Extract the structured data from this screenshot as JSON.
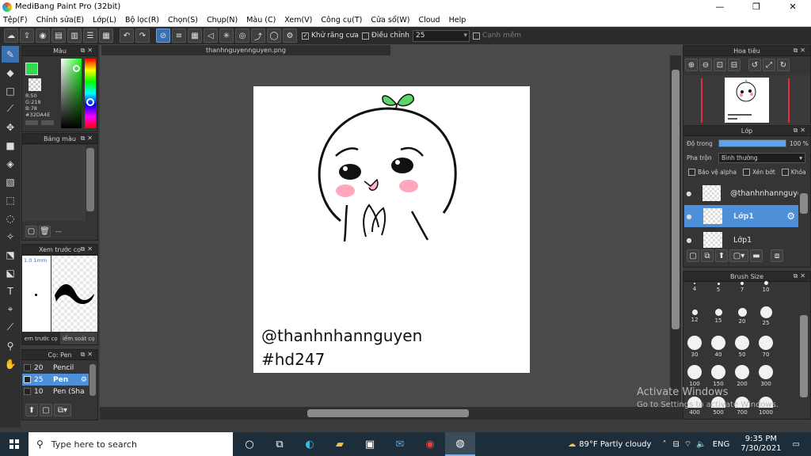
{
  "window": {
    "title": "MediBang Paint Pro (32bit)",
    "minimize": "—",
    "maximize": "❐",
    "close": "✕"
  },
  "menu": [
    "Tệp(F)",
    "Chỉnh sửa(E)",
    "Lớp(L)",
    "Bộ lọc(R)",
    "Chọn(S)",
    "Chụp(N)",
    "Màu (C)",
    "Xem(V)",
    "Công cụ(T)",
    "Cửa sổ(W)",
    "Cloud",
    "Help"
  ],
  "toolbar": {
    "antialias_label": "Khử răng cưa",
    "antialias_checked": true,
    "adjust_label": "Điều chỉnh",
    "adjust_value": "25",
    "edge_label": "Cạnh mềm",
    "edge_checked": false
  },
  "document": {
    "tab_title": "thanhnguyennguyen.png",
    "canvas_text_1": "@thanhnhannguyen",
    "canvas_text_2": "#hd247"
  },
  "color_panel": {
    "title": "Màu",
    "current_color": "#32DA4E",
    "r": "R:50",
    "g": "G:218",
    "b": "B:78",
    "hex": "#32DA4E"
  },
  "palette_panel": {
    "title": "Bảng màu",
    "footer": "---"
  },
  "preview_panel": {
    "title": "Xem trước cọ",
    "size": "1.0 1mm",
    "tab1": "em trước cọ",
    "tab2": "iểm soát cọ"
  },
  "brush_panel": {
    "title": "Cọ: Pen",
    "items": [
      {
        "size": "20",
        "name": "Pencil",
        "selected": false
      },
      {
        "size": "25",
        "name": "Pen",
        "selected": true
      },
      {
        "size": "10",
        "name": "Pen (Sha",
        "selected": false
      }
    ]
  },
  "navigator_panel": {
    "title": "Hoa tiêu"
  },
  "layer_panel": {
    "title": "Lớp",
    "opacity_label": "Độ trong",
    "opacity_value": "100 %",
    "opacity_fraction": 1.0,
    "blend_label": "Pha trộn",
    "blend_value": "Bình thường",
    "alpha_label": "Bảo vệ alpha",
    "clip_label": "Xén bớt",
    "lock_label": "Khóa",
    "layers": [
      {
        "name": "@thanhnhannguye",
        "selected": false
      },
      {
        "name": "Lớp1",
        "selected": true
      },
      {
        "name": "Lớp1",
        "selected": false
      }
    ]
  },
  "brushsize_panel": {
    "title": "Brush Size",
    "sizes": [
      "4",
      "5",
      "7",
      "10",
      "12",
      "15",
      "20",
      "25",
      "30",
      "40",
      "50",
      "70",
      "100",
      "150",
      "200",
      "300",
      "400",
      "500",
      "700",
      "1000"
    ]
  },
  "watermark": {
    "line1": "Activate Windows",
    "line2": "Go to Settings to activate Windows."
  },
  "taskbar": {
    "search_placeholder": "Type here to search",
    "weather": "89°F  Partly cloudy",
    "lang": "ENG",
    "time": "9:35 PM",
    "date": "7/30/2021"
  }
}
